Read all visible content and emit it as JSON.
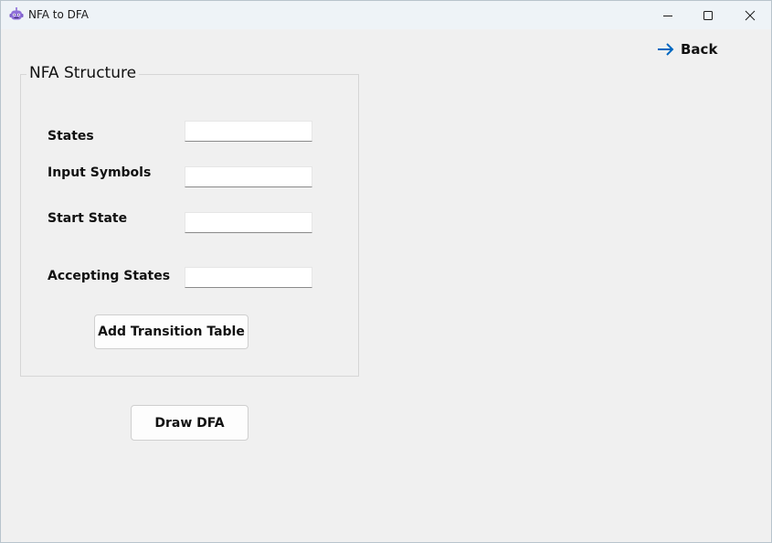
{
  "window": {
    "title": "NFA to DFA",
    "accent_color": "#0067c0"
  },
  "nav": {
    "back_label": "Back"
  },
  "nfa_structure": {
    "group_title": "NFA Structure",
    "fields": [
      {
        "label": "States",
        "value": ""
      },
      {
        "label": "Input Symbols",
        "value": ""
      },
      {
        "label": "Start State",
        "value": ""
      },
      {
        "label": "Accepting States",
        "value": ""
      }
    ],
    "add_transition_label": "Add Transition Table"
  },
  "actions": {
    "draw_dfa_label": "Draw DFA"
  }
}
